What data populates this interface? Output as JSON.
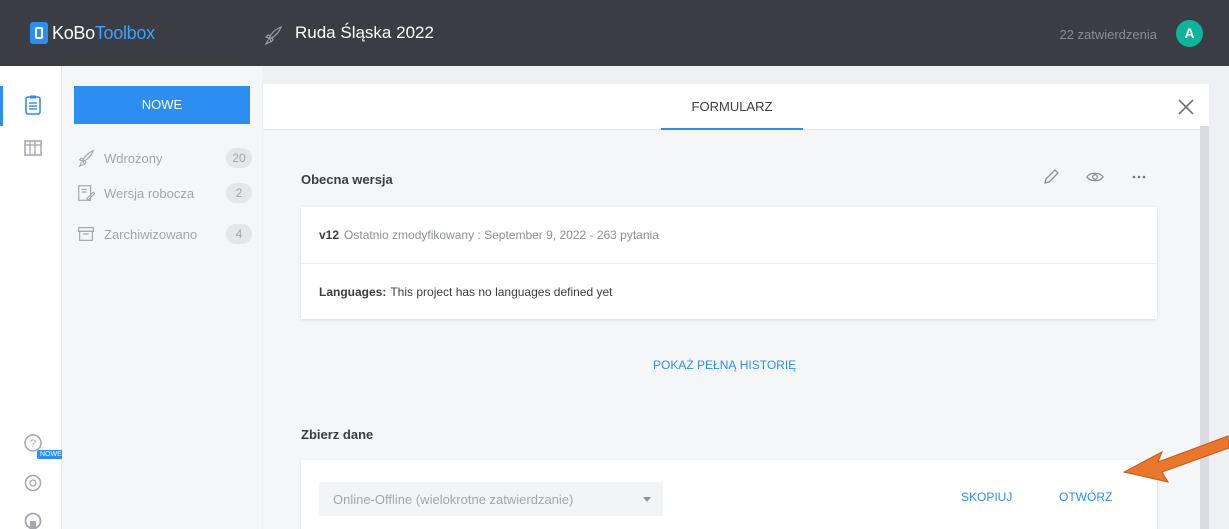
{
  "header": {
    "logo_kobo": "KoBo",
    "logo_toolbox": "Toolbox",
    "project_title": "Ruda Śląska 2022",
    "submissions": "22 zatwierdzenia",
    "avatar_letter": "A"
  },
  "rail": {
    "icons": [
      "projects-icon",
      "library-icon"
    ],
    "bottom_icons": [
      "help-icon",
      "support-icon",
      "github-icon"
    ],
    "new_badge": "NOWE"
  },
  "sidebar": {
    "new_button": "NOWE",
    "items": [
      {
        "label": "Wdrożony",
        "count": "20",
        "icon": "rocket-icon"
      },
      {
        "label": "Wersja robocza",
        "count": "2",
        "icon": "draft-icon"
      },
      {
        "label": "Zarchiwizowano",
        "count": "4",
        "icon": "archive-icon"
      }
    ]
  },
  "main": {
    "tab": "FORMULARZ",
    "current_version": {
      "title": "Obecna wersja",
      "version": "v12",
      "modified": "Ostatnio zmodyfikowany : September 9, 2022 - 263 pytania",
      "languages_label": "Languages:",
      "languages_text": "This project has no languages defined yet"
    },
    "history_link": "POKAŻ PEŁNĄ HISTORIĘ",
    "collect": {
      "title": "Zbierz dane",
      "select_value": "Online-Offline (wielokrotne zatwierdzanie)",
      "copy": "SKOPIUJ",
      "open": "OTWÓRZ"
    }
  },
  "colors": {
    "topbar": "#3b3d44",
    "accent": "#2c8ef0",
    "avatar": "#0fb59a",
    "arrow": "#e8762d"
  }
}
